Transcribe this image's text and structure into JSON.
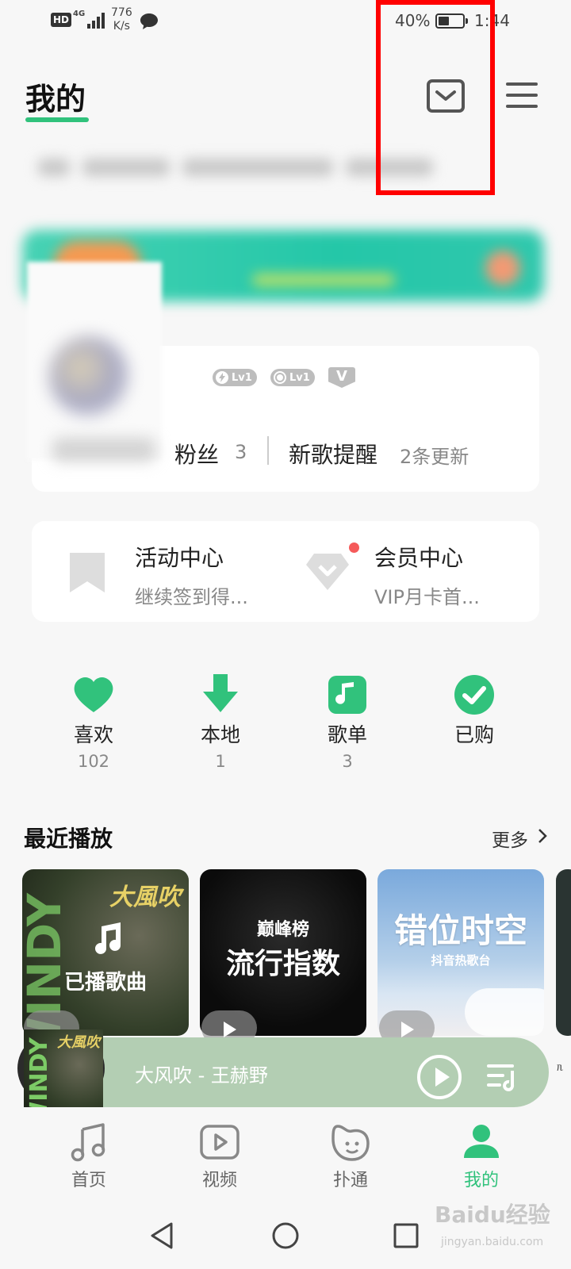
{
  "status_bar": {
    "hd": "HD",
    "network": "4G",
    "speed_value": "776",
    "speed_unit": "K/s",
    "battery": "40%",
    "time": "1:44"
  },
  "header": {
    "title": "我的"
  },
  "profile": {
    "badge_1": "Lv1",
    "badge_2": "Lv1",
    "fans_label": "粉丝",
    "fans_count": "3",
    "new_song_label": "新歌提醒",
    "new_song_value": "2条更新"
  },
  "activity": {
    "title": "活动中心",
    "subtitle": "继续签到得..."
  },
  "vip": {
    "title": "会员中心",
    "subtitle": "VIP月卡首..."
  },
  "quick_actions": [
    {
      "label": "喜欢",
      "count": "102",
      "icon": "heart-icon"
    },
    {
      "label": "本地",
      "count": "1",
      "icon": "download-icon"
    },
    {
      "label": "歌单",
      "count": "3",
      "icon": "music-note-icon"
    },
    {
      "label": "已购",
      "count": "",
      "icon": "check-circle-icon"
    }
  ],
  "recent": {
    "title": "最近播放",
    "more": "更多",
    "items": [
      {
        "cover_title": "大風吹",
        "label": "已播歌曲",
        "cover_side": "WINDY"
      },
      {
        "cover_small": "巅峰榜",
        "label": "流行指数"
      },
      {
        "label": "错位时空",
        "cover_small": "抖音热歌台"
      }
    ]
  },
  "player": {
    "song": "大风吹 - 王赫野",
    "cover_title": "大風吹",
    "cover_side": "WINDY",
    "side_text": "ᥰ"
  },
  "tabs": [
    {
      "label": "首页",
      "icon": "music-icon"
    },
    {
      "label": "视频",
      "icon": "video-icon"
    },
    {
      "label": "扑通",
      "icon": "face-icon"
    },
    {
      "label": "我的",
      "icon": "person-icon",
      "active": true
    }
  ],
  "watermark": {
    "brand": "Baidu经验",
    "url": "jingyan.baidu.com"
  },
  "colors": {
    "accent": "#31c27c",
    "highlight_box": "#ff0000",
    "player_bg": "#b3ceb3"
  }
}
